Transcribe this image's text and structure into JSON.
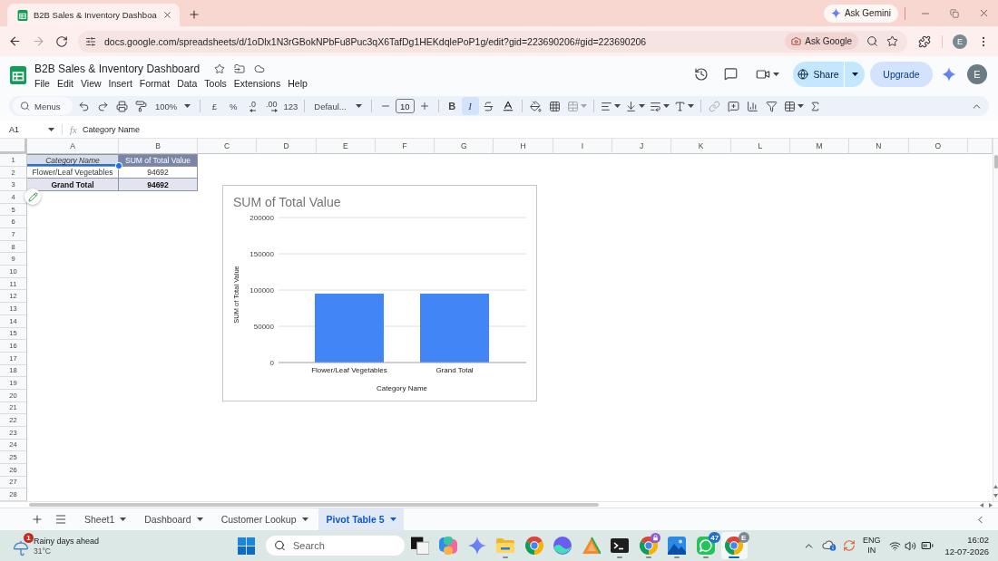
{
  "browser": {
    "tabs": [
      {
        "title": "B2B Sales & Inventory Dashboa",
        "selected": true
      }
    ],
    "ask_gemini": "Ask Gemini",
    "forward_disabled": true,
    "url": "docs.google.com/spreadsheets/d/1oDlx1N3rGBokNPbFu8Puc3qX6TafDg1HEKdqlePoP1g/edit?gid=223690206#gid=223690206",
    "ask_google": "Ask Google",
    "profile": "E"
  },
  "document": {
    "title": "B2B Sales & Inventory Dashboard",
    "menus": [
      "File",
      "Edit",
      "View",
      "Insert",
      "Format",
      "Data",
      "Tools",
      "Extensions",
      "Help"
    ],
    "share": "Share",
    "upgrade": "Upgrade",
    "avatar": "E"
  },
  "toolbar": {
    "search_placeholder": "Menus",
    "zoom": "100%",
    "currency": "£",
    "percent": "%",
    "decrease_decimals": ".0",
    "increase_decimals": ".00",
    "number_format": "123",
    "font": "Defaul...",
    "font_size": "10",
    "bold": {
      "label": "B",
      "selected": false
    },
    "italic": {
      "label": "I",
      "selected": true
    },
    "merge_disabled": true,
    "link_disabled": true
  },
  "formula_bar": {
    "cell": "A1",
    "fx": "fx",
    "content": "Category Name"
  },
  "sheet": {
    "columns": [
      "A",
      "B",
      "C",
      "D",
      "E",
      "F",
      "G",
      "H",
      "I",
      "J",
      "K",
      "L",
      "M",
      "N",
      "O"
    ],
    "rows": [
      "1",
      "2",
      "3",
      "4",
      "5",
      "6",
      "7",
      "8",
      "9",
      "10",
      "11",
      "12",
      "13",
      "14",
      "15",
      "16",
      "17",
      "18",
      "19",
      "20",
      "21",
      "22",
      "23",
      "24",
      "25",
      "26",
      "27",
      "28"
    ],
    "pivot_table": {
      "rows": [
        {
          "cells": [
            {
              "text": "Category Name",
              "kind": "row_header",
              "selected": true
            },
            {
              "text": "SUM of Total Value",
              "kind": "value_header",
              "selected": false
            }
          ]
        },
        {
          "cells": [
            {
              "text": "Flower/Leaf Vegetables",
              "kind": "label",
              "selected": false
            },
            {
              "text": "94692",
              "kind": "value",
              "selected": false
            }
          ]
        },
        {
          "cells": [
            {
              "text": "Grand Total",
              "kind": "total",
              "selected": false
            },
            {
              "text": "94692",
              "kind": "total",
              "selected": false
            }
          ]
        }
      ]
    },
    "chart": {
      "chart_data": [
        {
          "type": "bar",
          "title": "SUM of Total Value",
          "xlabel": "Category Name",
          "ylabel": "SUM of Total Value",
          "categories": [
            "Flower/Leaf Vegetables",
            "Grand Total"
          ],
          "values": [
            95000,
            95000
          ],
          "color": "#4285f4",
          "ylim": [
            0,
            200000
          ],
          "yticks": [
            0,
            50000,
            100000,
            150000,
            200000
          ],
          "grid": true
        }
      ]
    }
  },
  "sheet_tabs": [
    {
      "label": "Sheet1",
      "selected": false
    },
    {
      "label": "Dashboard",
      "selected": false
    },
    {
      "label": "Customer Lookup",
      "selected": false
    },
    {
      "label": "Pivot Table 5",
      "selected": true
    }
  ],
  "taskbar": {
    "weather": {
      "badge": "1",
      "headline": "Rainy days ahead",
      "temperature": "31°C"
    },
    "search_placeholder": "Search",
    "apps": [
      {
        "kind": "task_view",
        "running": false,
        "selected": false
      },
      {
        "kind": "copilot",
        "running": false,
        "selected": false
      },
      {
        "kind": "sparkle",
        "running": false,
        "selected": false
      },
      {
        "kind": "folder",
        "running": true,
        "selected": false
      },
      {
        "kind": "browser",
        "running": false,
        "selected": false
      },
      {
        "kind": "wave",
        "running": false,
        "selected": false
      },
      {
        "kind": "triangles",
        "running": false,
        "selected": false
      },
      {
        "kind": "terminal",
        "running": true,
        "selected": false
      },
      {
        "kind": "browser_locked",
        "running": true,
        "selected": false
      },
      {
        "kind": "photos",
        "running": true,
        "selected": false
      },
      {
        "kind": "chat",
        "running": true,
        "selected": false,
        "badge": "47"
      },
      {
        "kind": "browser",
        "running": true,
        "selected": true,
        "badge": "E"
      }
    ],
    "language": "ENG",
    "region": "IN",
    "time": "16:02",
    "date": "12-07-2026"
  }
}
